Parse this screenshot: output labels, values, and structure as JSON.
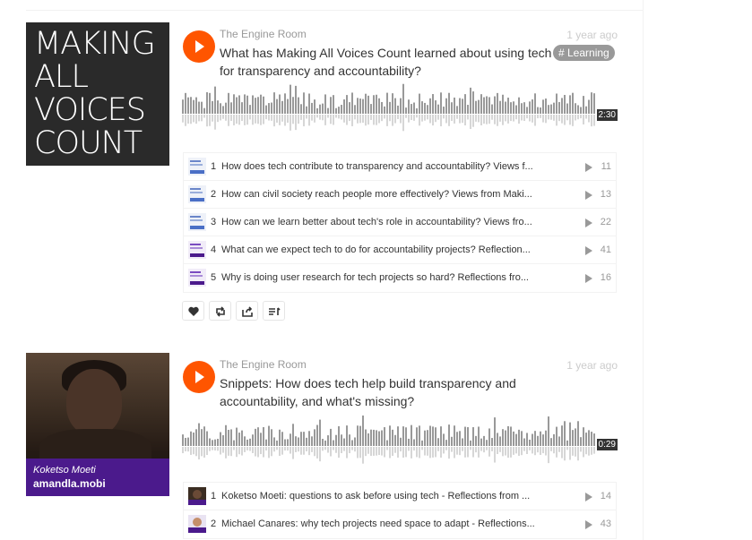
{
  "tracks": [
    {
      "artwork": {
        "lines": [
          "MAKING",
          "ALL",
          "VOICES",
          "COUNT"
        ]
      },
      "uploader": "The Engine Room",
      "time_ago": "1 year ago",
      "title": "What has Making All Voices Count learned about using tech for transparency and accountability?",
      "tag": "# Learning",
      "duration": "2:30",
      "items": [
        {
          "index": "1",
          "title": "How does tech contribute to transparency and accountability? Views f...",
          "plays": "11"
        },
        {
          "index": "2",
          "title": "How can civil society reach people more effectively? Views from Maki...",
          "plays": "13"
        },
        {
          "index": "3",
          "title": "How can we learn better about tech's role in accountability? Views fro...",
          "plays": "22"
        },
        {
          "index": "4",
          "title": "What can we expect tech to do for accountability projects? Reflection...",
          "plays": "41"
        },
        {
          "index": "5",
          "title": "Why is doing user research for tech projects so hard? Reflections fro...",
          "plays": "16"
        }
      ],
      "actions": [
        "like-icon",
        "repost-icon",
        "share-icon",
        "add-to-playlist-icon"
      ]
    },
    {
      "artwork": {
        "caption_name": "Koketso Moeti",
        "caption_site": "amandla.mobi"
      },
      "uploader": "The Engine Room",
      "time_ago": "1 year ago",
      "title": "Snippets: How does tech help build transparency and accountability, and what's missing?",
      "duration": "0:29",
      "items": [
        {
          "index": "1",
          "title": "Koketso Moeti: questions to ask before using tech - Reflections from ...",
          "plays": "14"
        },
        {
          "index": "2",
          "title": "Michael Canares: why tech projects need space to adapt - Reflections...",
          "plays": "43"
        }
      ]
    }
  ],
  "colors": {
    "accent": "#ff5500",
    "waveform": "#999999",
    "caption_bg": "#4b1a8c"
  }
}
